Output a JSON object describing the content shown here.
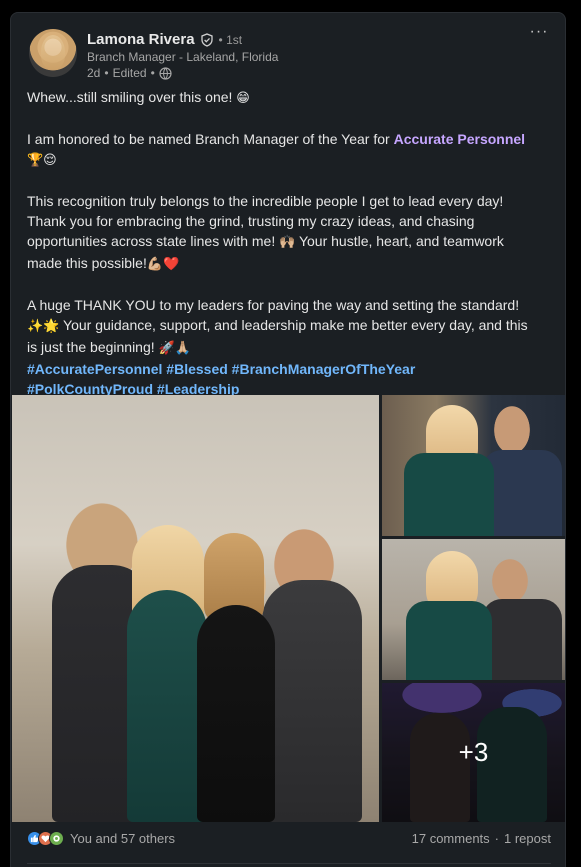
{
  "post": {
    "author": {
      "name": "Lamona Rivera",
      "degree": "• 1st",
      "headline": "Branch Manager - Lakeland, Florida",
      "time": "2d",
      "edited": "Edited",
      "separator": "•",
      "visibility_icon": "globe-icon",
      "verified_icon": "verified-shield-icon"
    },
    "menu_label": "···",
    "text": {
      "line1": "Whew...still smiling over this one!",
      "line1_emoji": "😁",
      "line2_prefix": "I am honored to be named Branch Manager of the Year for ",
      "line2_mention": "Accurate Personnel",
      "line2_emoji": "🏆😌",
      "para3_a": "This recognition truly belongs to the incredible people I get to lead every day!",
      "para3_b": "Thank you for embracing the grind, trusting my crazy ideas, and chasing",
      "para3_c": "opportunities across state lines with me!",
      "para3_c_emoji": "🙌🏼",
      "para3_c_rest": " Your hustle, heart, and teamwork",
      "para3_d": "made this possible!",
      "para3_d_emoji": "💪🏼❤️",
      "para4_a": "A huge THANK YOU to my leaders for paving the way and setting the standard!",
      "para4_b_emoji": "✨🌟",
      "para4_b": " Your guidance, support, and leadership make me better every day, and this",
      "para4_c": "is just the beginning!",
      "para4_c_emoji": "🚀🙏🏼"
    },
    "hashtags": [
      "#AccuratePersonnel",
      "#Blessed",
      "#BranchManagerOfTheYear",
      "#PolkCountyProud",
      "#Leadership"
    ],
    "photos": {
      "more_count": "+3"
    },
    "social": {
      "reaction_icons": [
        "like-icon",
        "love-icon",
        "support-icon"
      ],
      "reactions_text": "You and 57 others",
      "comments": "17 comments",
      "separator": "·",
      "reposts": "1 repost"
    },
    "colors": {
      "background": "#000000",
      "card": "#1b1f23",
      "mention": "#c6a6ff",
      "hashtag": "#71b7fb"
    }
  }
}
